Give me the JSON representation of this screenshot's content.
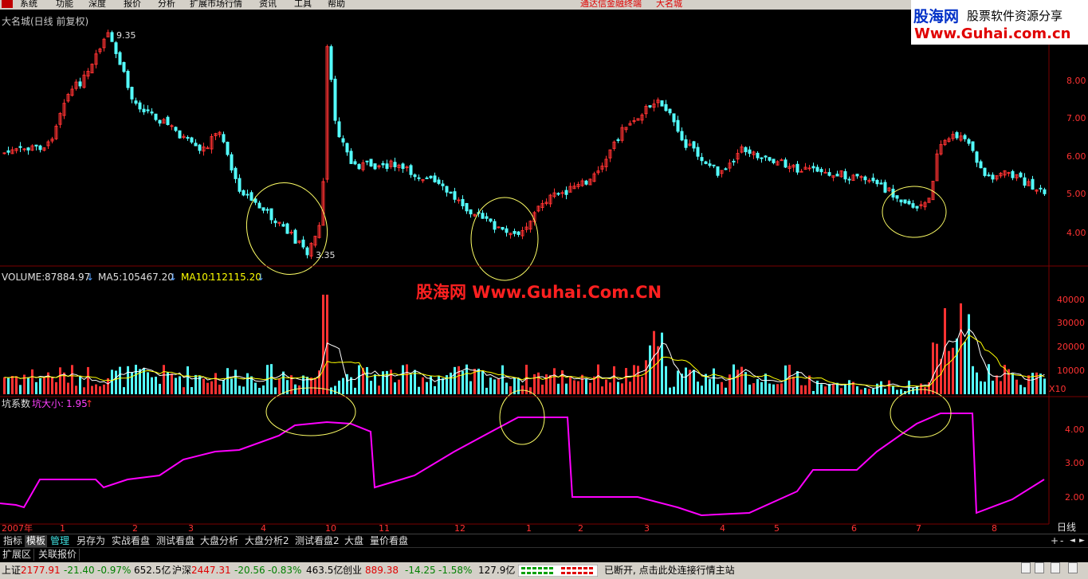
{
  "menu": {
    "items": [
      "系统",
      "功能",
      "深度",
      "报价",
      "分析",
      "扩展市场行情",
      "资讯",
      "工具",
      "帮助"
    ],
    "title_app": "通达信金融终端",
    "title_stock": "大名城"
  },
  "brand": {
    "name": "股海网",
    "slogan": "股票软件资源分享",
    "url": "Www.Guhai.com.cn"
  },
  "main_chart": {
    "title": "大名城(日线 前复权)",
    "high_label": "9.35",
    "low_label": "3.35",
    "y_ticks": [
      "8.00",
      "7.00",
      "6.00",
      "5.00",
      "4.00"
    ]
  },
  "volume_panel": {
    "label": "VOLUME:",
    "value": "87884.97",
    "ma5_label": "MA5:",
    "ma5_value": "105467.20",
    "ma10_label": "MA10:",
    "ma10_value": "112115.20",
    "y_ticks": [
      "40000",
      "30000",
      "20000",
      "10000"
    ],
    "multiplier": "X10"
  },
  "watermark": "股海网 Www.Guhai.Com.CN",
  "indicator_panel": {
    "name": "坑系数",
    "sub_label": "坑大小:",
    "sub_value": "1.95",
    "y_ticks": [
      "4.00",
      "3.00",
      "2.00"
    ]
  },
  "x_axis": {
    "labels": [
      "2007年",
      "1",
      "2",
      "3",
      "4",
      "10",
      "11",
      "12",
      "1",
      "2",
      "3",
      "4",
      "5",
      "6",
      "7",
      "8"
    ],
    "period": "日线"
  },
  "tabs": [
    {
      "label": "指标"
    },
    {
      "label": "模板"
    },
    {
      "label": "管理"
    },
    {
      "label": "另存为"
    },
    {
      "label": "实战看盘"
    },
    {
      "label": "测试看盘"
    },
    {
      "label": "大盘分析"
    },
    {
      "label": "大盘分析2"
    },
    {
      "label": "测试看盘2"
    },
    {
      "label": "大盘"
    },
    {
      "label": "量价看盘"
    }
  ],
  "tab_controls": [
    "+",
    "-",
    "◄",
    "►"
  ],
  "ext_bar": [
    "扩展区",
    "关联报价"
  ],
  "status": {
    "sh_name": "上证",
    "sh_index": "2177.91",
    "sh_change": "-21.40",
    "sh_pct": "-0.97%",
    "sh_amount": "652.5亿",
    "hs_name": "沪深",
    "hs_index": "2447.31",
    "hs_change": "-20.56",
    "hs_pct": "-0.83%",
    "hs_amount": "463.5亿",
    "cy_name": "创业",
    "cy_index": "889.38",
    "cy_change": "-14.25",
    "cy_pct": "-1.58%",
    "cy_amount": "127.9亿",
    "connection": "已断开, 点击此处连接行情主站"
  },
  "colors": {
    "up": "#ff3232",
    "down": "#54ffff",
    "ma5": "#ffffff",
    "ma10": "#ffff00",
    "indicator": "#ff00ff",
    "annotation": "#ffff66"
  }
}
